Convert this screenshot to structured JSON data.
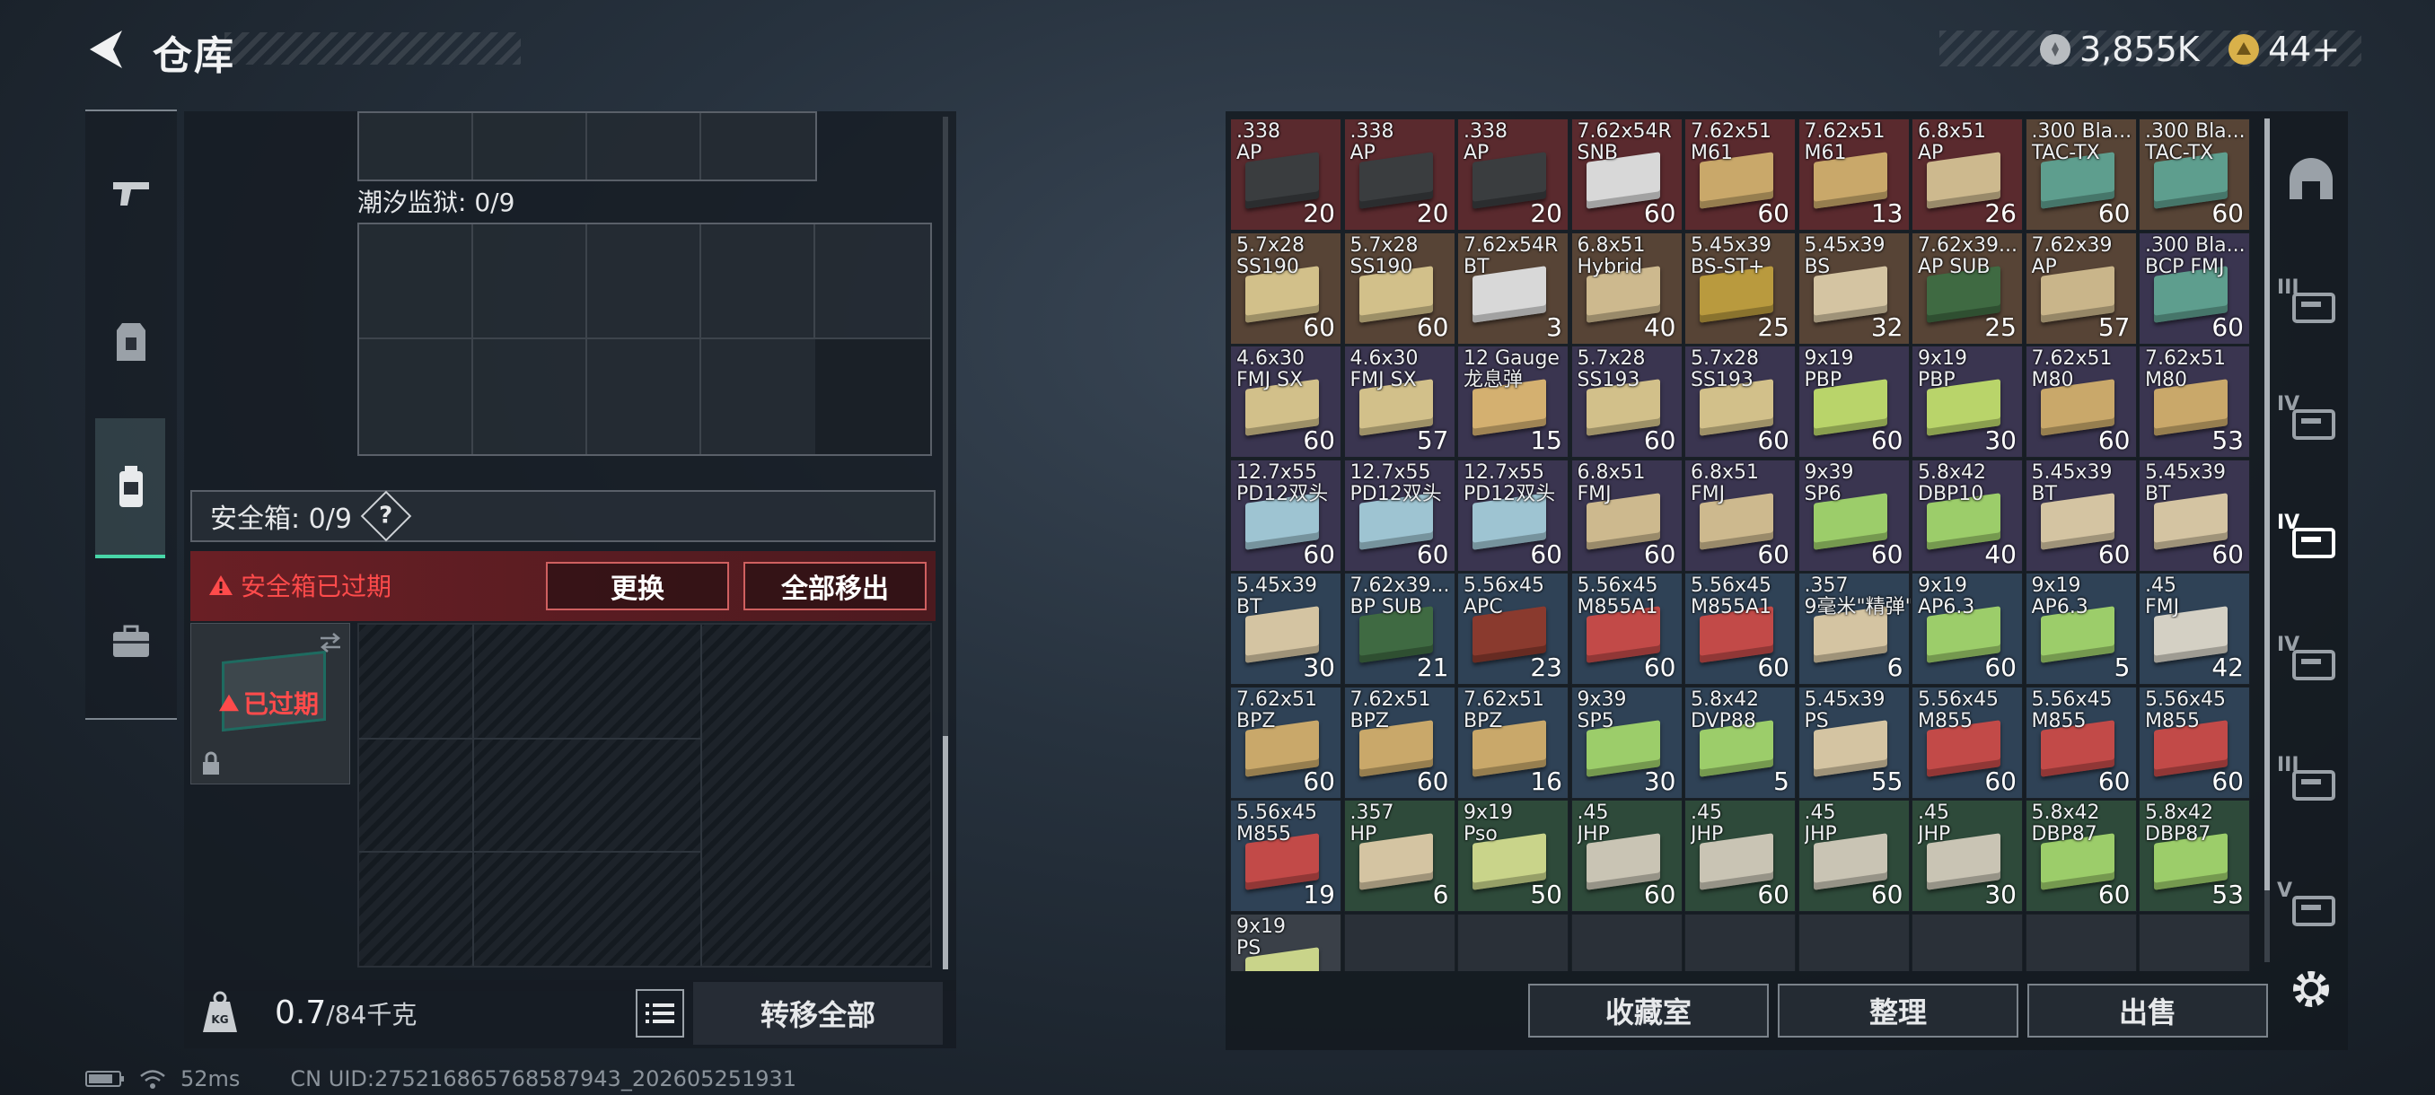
{
  "header": {
    "title": "仓库",
    "currencies": [
      {
        "icon": "silver-coin-icon",
        "value": "3,855K",
        "color": "#c9cdd1"
      },
      {
        "icon": "gold-coin-icon",
        "value": "44+",
        "color": "#d9b14a"
      }
    ]
  },
  "left_panel": {
    "prison_label": "潮汐监狱: 0/9",
    "safebox_label": "安全箱: 0/9",
    "help": "?",
    "expired_warning": "安全箱已过期",
    "replace_button": "更换",
    "move_all_button": "全部移出",
    "case_status": "已过期",
    "weight": "0.7",
    "weight_max": "/84千克",
    "transfer_all_button": "转移全部"
  },
  "status_bar": {
    "ping": "52ms",
    "uid": "CN UID:275216865768587943_202605251931"
  },
  "items": [
    {
      "name": ".338\nAP",
      "count": "20",
      "bg": "#5a2a2e",
      "box": "#3a3d3f"
    },
    {
      "name": ".338\nAP",
      "count": "20",
      "bg": "#5a2a2e",
      "box": "#3a3d3f"
    },
    {
      "name": ".338\nAP",
      "count": "20",
      "bg": "#5a2a2e",
      "box": "#3a3d3f"
    },
    {
      "name": "7.62x54R\nSNB",
      "count": "60",
      "bg": "#5a2a2e",
      "box": "#d8d8d8"
    },
    {
      "name": "7.62x51\nM61",
      "count": "60",
      "bg": "#5a2a2e",
      "box": "#c9a86a"
    },
    {
      "name": "7.62x51\nM61",
      "count": "13",
      "bg": "#5a2a2e",
      "box": "#c9a86a"
    },
    {
      "name": "6.8x51\nAP",
      "count": "26",
      "bg": "#5a2a2e",
      "box": "#cdb98e"
    },
    {
      "name": ".300 Bla...\nTAC-TX",
      "count": "60",
      "bg": "#574436",
      "box": "#5e9e8e"
    },
    {
      "name": ".300 Bla...\nTAC-TX",
      "count": "60",
      "bg": "#574436",
      "box": "#5e9e8e"
    },
    {
      "name": "5.7x28\nSS190",
      "count": "60",
      "bg": "#574436",
      "box": "#d2c08a"
    },
    {
      "name": "5.7x28\nSS190",
      "count": "60",
      "bg": "#574436",
      "box": "#d2c08a"
    },
    {
      "name": "7.62x54R\nBT",
      "count": "3",
      "bg": "#574436",
      "box": "#d8d8d8"
    },
    {
      "name": "6.8x51\nHybrid",
      "count": "40",
      "bg": "#574436",
      "box": "#cdb98e"
    },
    {
      "name": "5.45x39\nBS-ST+",
      "count": "25",
      "bg": "#574436",
      "box": "#b99a3e"
    },
    {
      "name": "5.45x39\nBS",
      "count": "32",
      "bg": "#574436",
      "box": "#d4c4a2"
    },
    {
      "name": "7.62x39...\nAP SUB",
      "count": "25",
      "bg": "#574436",
      "box": "#3f6a42"
    },
    {
      "name": "7.62x39\nAP",
      "count": "57",
      "bg": "#574436",
      "box": "#c9b58a"
    },
    {
      "name": ".300 Bla...\nBCP FMJ",
      "count": "60",
      "bg": "#3a3550",
      "box": "#5e9e8e"
    },
    {
      "name": "4.6x30\nFMJ SX",
      "count": "60",
      "bg": "#3a3550",
      "box": "#d2c08a"
    },
    {
      "name": "4.6x30\nFMJ SX",
      "count": "57",
      "bg": "#3a3550",
      "box": "#d2c08a"
    },
    {
      "name": "12 Gauge\n龙息弹",
      "count": "15",
      "bg": "#3a3550",
      "box": "#d4b070"
    },
    {
      "name": "5.7x28\nSS193",
      "count": "60",
      "bg": "#3a3550",
      "box": "#d2c08a"
    },
    {
      "name": "5.7x28\nSS193",
      "count": "60",
      "bg": "#3a3550",
      "box": "#d2c08a"
    },
    {
      "name": "9x19\nPBP",
      "count": "60",
      "bg": "#3a3550",
      "box": "#b9d46a"
    },
    {
      "name": "9x19\nPBP",
      "count": "30",
      "bg": "#3a3550",
      "box": "#b9d46a"
    },
    {
      "name": "7.62x51\nM80",
      "count": "60",
      "bg": "#3a3550",
      "box": "#c9a86a"
    },
    {
      "name": "7.62x51\nM80",
      "count": "53",
      "bg": "#3a3550",
      "box": "#c9a86a"
    },
    {
      "name": "12.7x55\nPD12双头",
      "count": "60",
      "bg": "#3a3550",
      "box": "#9ec4d2"
    },
    {
      "name": "12.7x55\nPD12双头",
      "count": "60",
      "bg": "#3a3550",
      "box": "#9ec4d2"
    },
    {
      "name": "12.7x55\nPD12双头",
      "count": "60",
      "bg": "#3a3550",
      "box": "#9ec4d2"
    },
    {
      "name": "6.8x51\nFMJ",
      "count": "60",
      "bg": "#3a3550",
      "box": "#cdb98e"
    },
    {
      "name": "6.8x51\nFMJ",
      "count": "60",
      "bg": "#3a3550",
      "box": "#cdb98e"
    },
    {
      "name": "9x39\nSP6",
      "count": "60",
      "bg": "#3a3550",
      "box": "#9ccd6a"
    },
    {
      "name": "5.8x42\nDBP10",
      "count": "40",
      "bg": "#3a3550",
      "box": "#9ccd6a"
    },
    {
      "name": "5.45x39\nBT",
      "count": "60",
      "bg": "#3a3550",
      "box": "#d4c4a2"
    },
    {
      "name": "5.45x39\nBT",
      "count": "60",
      "bg": "#3a3550",
      "box": "#d4c4a2"
    },
    {
      "name": "5.45x39\nBT",
      "count": "30",
      "bg": "#2f4256",
      "box": "#d4c4a2"
    },
    {
      "name": "7.62x39...\nBP SUB",
      "count": "21",
      "bg": "#2f4256",
      "box": "#3f6a42"
    },
    {
      "name": "5.56x45\nAPC",
      "count": "23",
      "bg": "#2f4256",
      "box": "#8a3a2e"
    },
    {
      "name": "5.56x45\nM855A1",
      "count": "60",
      "bg": "#2f4256",
      "box": "#c24a48"
    },
    {
      "name": "5.56x45\nM855A1",
      "count": "60",
      "bg": "#2f4256",
      "box": "#c24a48"
    },
    {
      "name": ".357\n9毫米\"精弹\"",
      "count": "6",
      "bg": "#2f4256",
      "box": "#d4c4a2"
    },
    {
      "name": "9x19\nAP6.3",
      "count": "60",
      "bg": "#2f4256",
      "box": "#9ccd6a"
    },
    {
      "name": "9x19\nAP6.3",
      "count": "5",
      "bg": "#2f4256",
      "box": "#9ccd6a"
    },
    {
      "name": ".45\nFMJ",
      "count": "42",
      "bg": "#2f4256",
      "box": "#d4d0c4"
    },
    {
      "name": "7.62x51\nBPZ",
      "count": "60",
      "bg": "#2f4256",
      "box": "#c9a86a"
    },
    {
      "name": "7.62x51\nBPZ",
      "count": "60",
      "bg": "#2f4256",
      "box": "#c9a86a"
    },
    {
      "name": "7.62x51\nBPZ",
      "count": "16",
      "bg": "#2f4256",
      "box": "#c9a86a"
    },
    {
      "name": "9x39\nSP5",
      "count": "30",
      "bg": "#2f4256",
      "box": "#9ccd6a"
    },
    {
      "name": "5.8x42\nDVP88",
      "count": "5",
      "bg": "#2f4256",
      "box": "#9ccd6a"
    },
    {
      "name": "5.45x39\nPS",
      "count": "55",
      "bg": "#2f4256",
      "box": "#d4c4a2"
    },
    {
      "name": "5.56x45\nM855",
      "count": "60",
      "bg": "#2f4256",
      "box": "#c24a48"
    },
    {
      "name": "5.56x45\nM855",
      "count": "60",
      "bg": "#2f4256",
      "box": "#c24a48"
    },
    {
      "name": "5.56x45\nM855",
      "count": "60",
      "bg": "#2f4256",
      "box": "#c24a48"
    },
    {
      "name": "5.56x45\nM855",
      "count": "19",
      "bg": "#2f4256",
      "box": "#c24a48"
    },
    {
      "name": ".357\nHP",
      "count": "6",
      "bg": "#2e4a3a",
      "box": "#d4c4a2"
    },
    {
      "name": "9x19\nPso",
      "count": "50",
      "bg": "#2e4a3a",
      "box": "#c9d48a"
    },
    {
      "name": ".45\nJHP",
      "count": "60",
      "bg": "#2e4a3a",
      "box": "#c9c4b4"
    },
    {
      "name": ".45\nJHP",
      "count": "60",
      "bg": "#2e4a3a",
      "box": "#c9c4b4"
    },
    {
      "name": ".45\nJHP",
      "count": "60",
      "bg": "#2e4a3a",
      "box": "#c9c4b4"
    },
    {
      "name": ".45\nJHP",
      "count": "30",
      "bg": "#2e4a3a",
      "box": "#c9c4b4"
    },
    {
      "name": "5.8x42\nDBP87",
      "count": "60",
      "bg": "#2e4a3a",
      "box": "#9ccd6a"
    },
    {
      "name": "5.8x42\nDBP87",
      "count": "53",
      "bg": "#2e4a3a",
      "box": "#9ccd6a"
    },
    {
      "name": "9x19\nPS",
      "count": "",
      "bg": "#3a4048",
      "box": "#c9d48a"
    }
  ],
  "bottom_buttons": [
    "收藏室",
    "整理",
    "出售"
  ],
  "right_rail": [
    {
      "icon": "helmet-icon",
      "label": ""
    },
    {
      "icon": "armor-level-3-icon",
      "label": "III"
    },
    {
      "icon": "medkit-level-4-icon",
      "label": "IV"
    },
    {
      "icon": "container-level-4-icon",
      "label": "IV"
    },
    {
      "icon": "container-level-4b-icon",
      "label": "IV"
    },
    {
      "icon": "container-level-3-icon",
      "label": "III"
    },
    {
      "icon": "container-level-5-icon",
      "label": "V"
    }
  ]
}
